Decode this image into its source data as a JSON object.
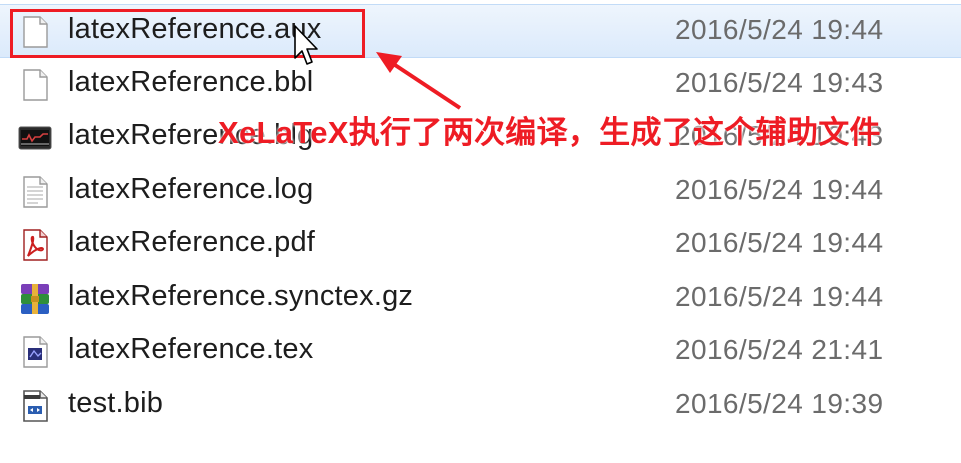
{
  "files": [
    {
      "name": "latexReference.aux",
      "date": "2016/5/24 19:44",
      "icon": "blank-document-icon",
      "selected": true
    },
    {
      "name": "latexReference.bbl",
      "date": "2016/5/24 19:43",
      "icon": "blank-document-icon",
      "selected": false
    },
    {
      "name": "latexReference.blg",
      "date": "2016/5/24 19:43",
      "icon": "monitor-app-icon",
      "selected": false
    },
    {
      "name": "latexReference.log",
      "date": "2016/5/24 19:44",
      "icon": "text-document-icon",
      "selected": false
    },
    {
      "name": "latexReference.pdf",
      "date": "2016/5/24 19:44",
      "icon": "pdf-icon",
      "selected": false
    },
    {
      "name": "latexReference.synctex.gz",
      "date": "2016/5/24 19:44",
      "icon": "archive-icon",
      "selected": false
    },
    {
      "name": "latexReference.tex",
      "date": "2016/5/24 21:41",
      "icon": "tex-document-icon",
      "selected": false
    },
    {
      "name": "test.bib",
      "date": "2016/5/24 19:39",
      "icon": "bib-document-icon",
      "selected": false
    }
  ],
  "annotation": {
    "text": "XeLaTeX执行了两次编译，生成了这个辅助文件",
    "color": "#ee1c24"
  },
  "colors": {
    "selection": "#dbeafb",
    "date_text": "#6b6b6b",
    "name_text": "#1d1d1d"
  }
}
